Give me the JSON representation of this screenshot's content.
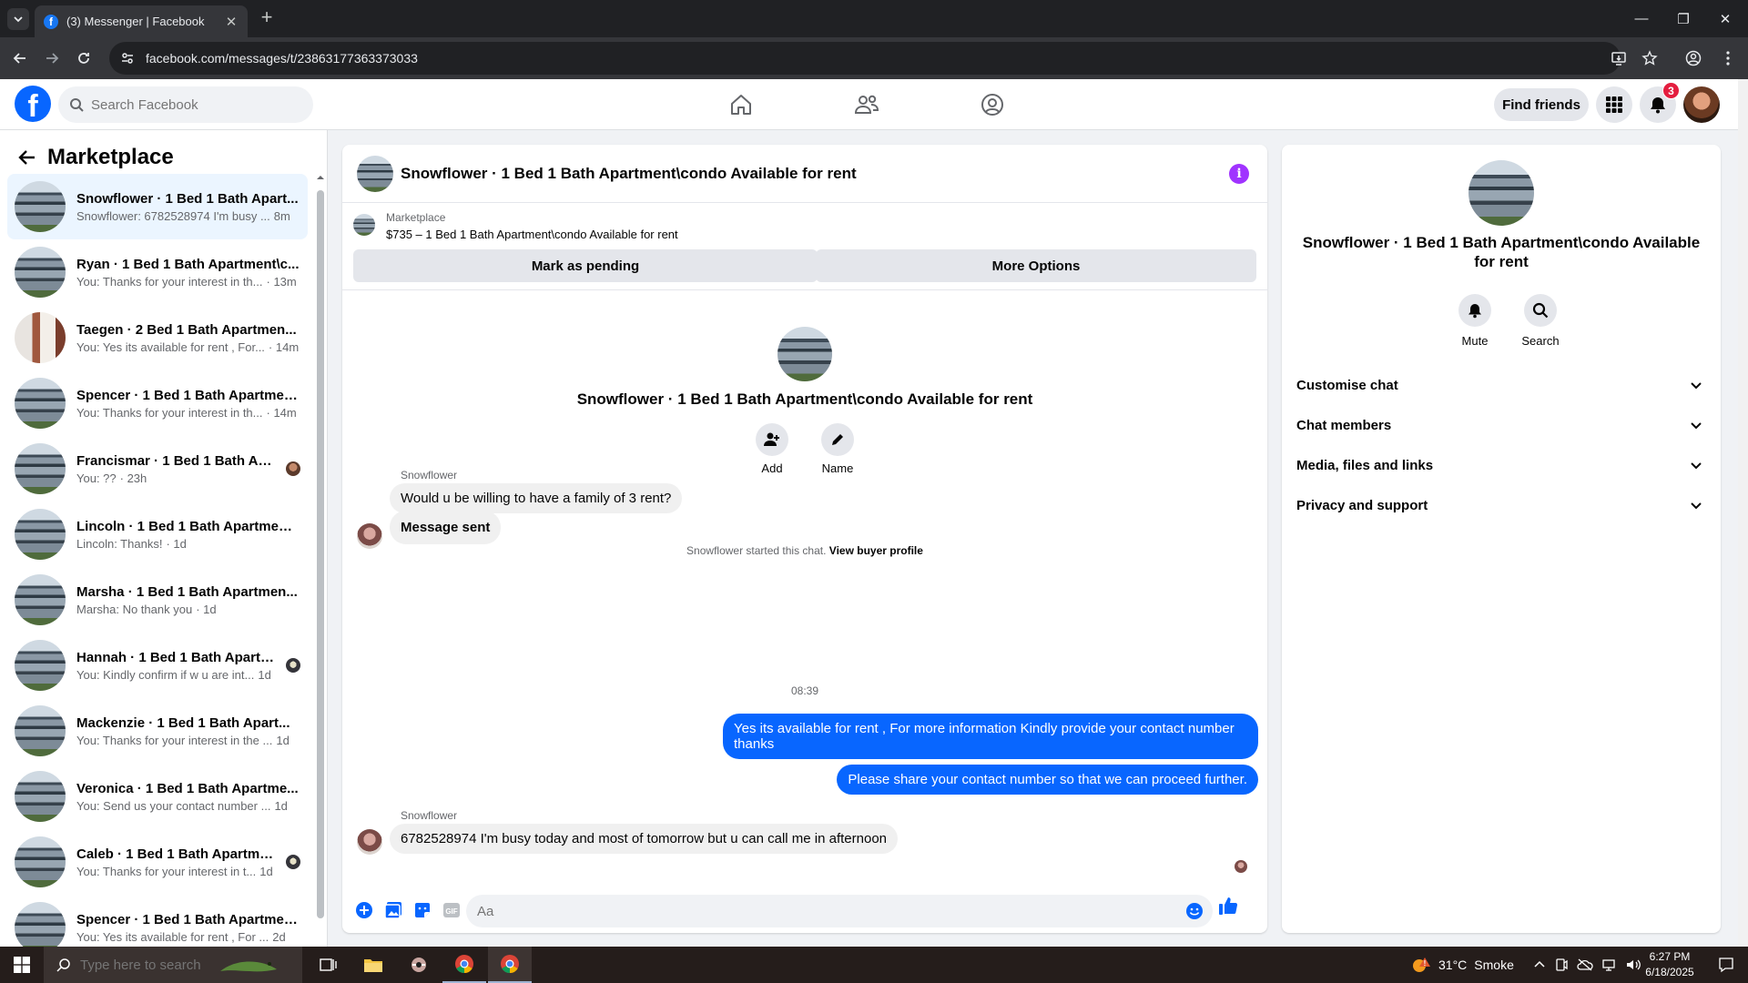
{
  "browser": {
    "tab_title": "(3) Messenger | Facebook",
    "url": "facebook.com/messages/t/23863177363373033"
  },
  "fb": {
    "search_placeholder": "Search Facebook",
    "find_friends": "Find friends",
    "notif_count": "3"
  },
  "left": {
    "title": "Marketplace",
    "conversations": [
      {
        "name": "Snowflower · 1 Bed 1 Bath Apart...",
        "snippet": "Snowflower: 6782528974 I'm busy ...",
        "time": "8m",
        "active": true
      },
      {
        "name": "Ryan · 1 Bed 1 Bath Apartment\\c...",
        "snippet": "You: Thanks for your interest in th...",
        "time": "· 13m"
      },
      {
        "name": "Taegen · 2 Bed 1 Bath Apartmen...",
        "snippet": "You: Yes its available for rent , For...",
        "time": "· 14m"
      },
      {
        "name": "Spencer · 1 Bed 1 Bath Apartmen...",
        "snippet": "You: Thanks for your interest in th...",
        "time": "· 14m"
      },
      {
        "name": "Francismar · 1 Bed 1 Bath Apar...",
        "snippet": "You: ??",
        "time": "· 23h"
      },
      {
        "name": "Lincoln · 1 Bed 1 Bath Apartment...",
        "snippet": "Lincoln: Thanks!",
        "time": "· 1d"
      },
      {
        "name": "Marsha · 1 Bed 1 Bath Apartmen...",
        "snippet": "Marsha: No thank you",
        "time": "· 1d"
      },
      {
        "name": "Hannah · 1 Bed 1 Bath Apartm...",
        "snippet": "You: Kindly confirm if w u are int...",
        "time": "1d"
      },
      {
        "name": "Mackenzie · 1 Bed 1 Bath Apart...",
        "snippet": "You: Thanks for your interest in the ...",
        "time": "1d"
      },
      {
        "name": "Veronica · 1 Bed 1 Bath Apartme...",
        "snippet": "You: Send us your contact number ...",
        "time": "1d"
      },
      {
        "name": "Caleb · 1 Bed 1 Bath Apartmen...",
        "snippet": "You: Thanks for your interest in t...",
        "time": "1d"
      },
      {
        "name": "Spencer · 1 Bed 1 Bath Apartmen...",
        "snippet": "You: Yes its available for rent , For ...",
        "time": "2d"
      }
    ]
  },
  "chat": {
    "title": "Snowflower · 1 Bed 1 Bath Apartment\\condo Available for rent",
    "marketplace_label": "Marketplace",
    "listing": "$735 – 1 Bed 1 Bath Apartment\\condo Available for rent",
    "mark_pending": "Mark as pending",
    "more_options": "More Options",
    "intro_title": "Snowflower · 1 Bed 1 Bath Apartment\\condo Available for rent",
    "add_label": "Add",
    "name_label": "Name",
    "started": "Snowflower started this chat.",
    "view_profile": "View buyer profile",
    "sender": "Snowflower",
    "msg1": "Would u be willing to have a family of 3 rent?",
    "msg2": "Message sent",
    "timestamp": "08:39",
    "out1": "Yes its  available for rent , For more information Kindly provide your contact number thanks",
    "out2": "Please share your contact number so that we can proceed further.",
    "sender2": "Snowflower",
    "msg3": "6782528974 I'm busy today and most of tomorrow but u can call me in afternoon",
    "composer_placeholder": "Aa"
  },
  "right": {
    "title": "Snowflower · 1 Bed 1 Bath Apartment\\condo Available for rent",
    "mute": "Mute",
    "search": "Search",
    "sections": [
      "Customise chat",
      "Chat members",
      "Media, files and links",
      "Privacy and support"
    ]
  },
  "taskbar": {
    "search_placeholder": "Type here to search",
    "temperature": "31°C",
    "weather": "Smoke",
    "time": "6:27 PM",
    "date": "6/18/2025"
  },
  "colors": {
    "fb_blue": "#0866ff",
    "info_purple": "#a033ff",
    "badge_red": "#e41e3f"
  }
}
